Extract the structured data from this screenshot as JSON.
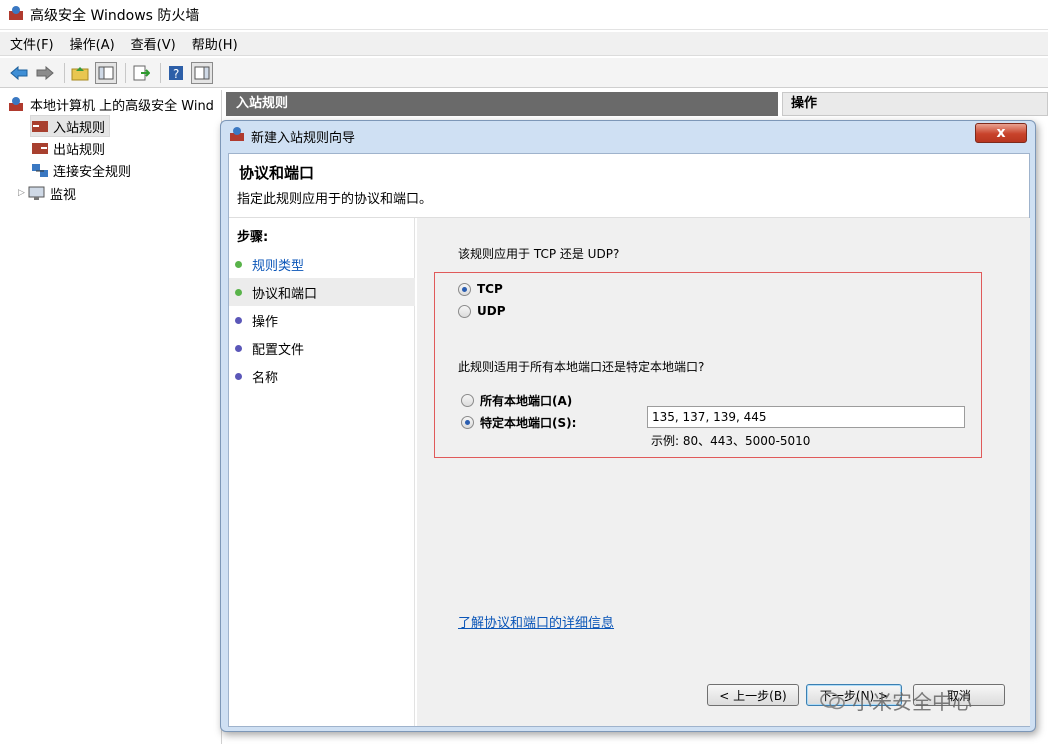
{
  "window": {
    "title": "高级安全 Windows 防火墙"
  },
  "menu": [
    "文件(F)",
    "操作(A)",
    "查看(V)",
    "帮助(H)"
  ],
  "tree": {
    "root": "本地计算机 上的高级安全 Wind",
    "items": [
      "入站规则",
      "出站规则",
      "连接安全规则",
      "监视"
    ]
  },
  "panes": {
    "middle_header": "入站规则",
    "actions_header": "操作"
  },
  "dialog": {
    "title": "新建入站规则向导",
    "heading": "协议和端口",
    "subheading": "指定此规则应用于的协议和端口。",
    "steps_title": "步骤:",
    "steps": [
      "规则类型",
      "协议和端口",
      "操作",
      "配置文件",
      "名称"
    ],
    "current_step": 1,
    "protocol_question": "该规则应用于 TCP 还是 UDP?",
    "protocol_options": [
      "TCP",
      "UDP"
    ],
    "protocol_selected": "TCP",
    "port_question": "此规则适用于所有本地端口还是特定本地端口?",
    "port_options": [
      "所有本地端口(A)",
      "特定本地端口(S):"
    ],
    "port_selected": "特定本地端口(S):",
    "port_value": "135, 137, 139, 445",
    "port_example": "示例: 80、443、5000-5010",
    "learn_link": "了解协议和端口的详细信息",
    "buttons": {
      "back": "< 上一步(B)",
      "next": "下一步(N) >",
      "cancel": "取消"
    },
    "close_glyph": "x"
  },
  "watermark": "小米安全中心",
  "colors": {
    "accent_link": "#0b56b8",
    "highlight_box": "#e05a5a",
    "step_done": "#59b34a",
    "step_pending": "#5b57b8"
  }
}
